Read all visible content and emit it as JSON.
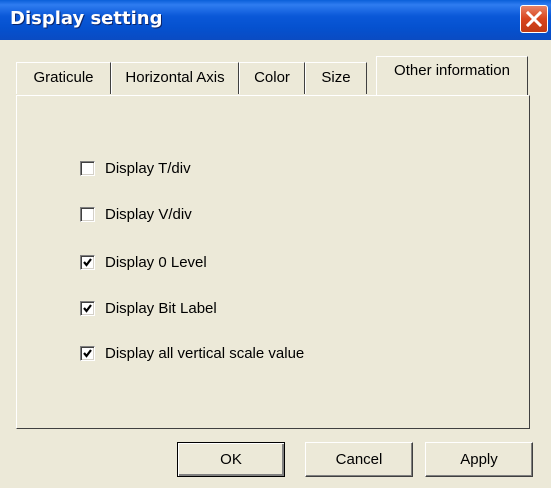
{
  "window": {
    "title": "Display setting"
  },
  "tabs": [
    {
      "label": "Graticule",
      "active": false
    },
    {
      "label": "Horizontal Axis",
      "active": false
    },
    {
      "label": "Color",
      "active": false
    },
    {
      "label": "Size",
      "active": false
    },
    {
      "label": "Other information",
      "active": true
    }
  ],
  "options": [
    {
      "label": "Display T/div",
      "checked": false
    },
    {
      "label": "Display V/div",
      "checked": false
    },
    {
      "label": "Display 0 Level",
      "checked": true
    },
    {
      "label": "Display Bit Label",
      "checked": true
    },
    {
      "label": "Display all vertical scale value",
      "checked": true
    }
  ],
  "buttons": {
    "ok": "OK",
    "cancel": "Cancel",
    "apply": "Apply"
  },
  "icons": {
    "close": "close-icon",
    "check": "checkmark-icon"
  },
  "colors": {
    "titlebar": "#0a58d8",
    "dialog_bg": "#ece9d8",
    "close_button": "#d8441c"
  }
}
